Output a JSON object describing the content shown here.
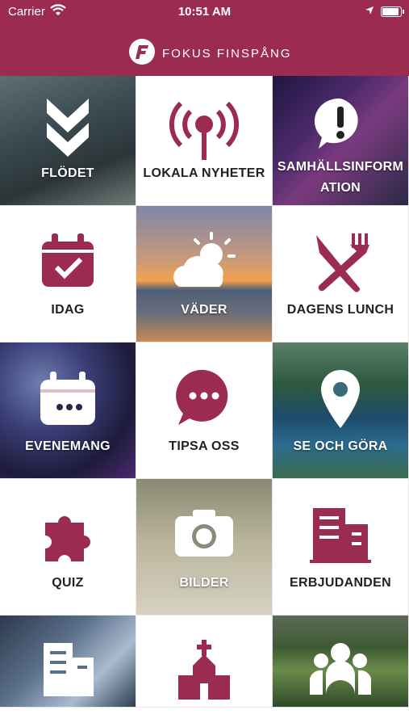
{
  "status_bar": {
    "carrier": "Carrier",
    "time": "10:51 AM"
  },
  "header": {
    "brand": "FOKUS FINSPÅNG"
  },
  "colors": {
    "brand": "#9b2c4f",
    "tile_light": "#ffffff"
  },
  "tiles": [
    {
      "label": "FLÖDET",
      "icon": "double-chevron-down-icon"
    },
    {
      "label": "LOKALA NYHETER",
      "icon": "radio-antenna-icon"
    },
    {
      "label": "SAMHÄLLSINFORM",
      "label2": "ATION",
      "icon": "exclamation-bubble-icon"
    },
    {
      "label": "IDAG",
      "icon": "calendar-check-icon"
    },
    {
      "label": "VÄDER",
      "icon": "sun-cloud-icon"
    },
    {
      "label": "DAGENS LUNCH",
      "icon": "fork-knife-icon"
    },
    {
      "label": "EVENEMANG",
      "icon": "calendar-dots-icon"
    },
    {
      "label": "TIPSA OSS",
      "icon": "chat-bubble-icon"
    },
    {
      "label": "SE OCH GÖRA",
      "icon": "map-pin-icon"
    },
    {
      "label": "QUIZ",
      "icon": "puzzle-icon"
    },
    {
      "label": "BILDER",
      "icon": "camera-icon"
    },
    {
      "label": "ERBJUDANDEN",
      "icon": "buildings-icon"
    },
    {
      "label": "",
      "icon": "office-building-icon"
    },
    {
      "label": "",
      "icon": "church-icon"
    },
    {
      "label": "",
      "icon": "group-icon"
    }
  ]
}
